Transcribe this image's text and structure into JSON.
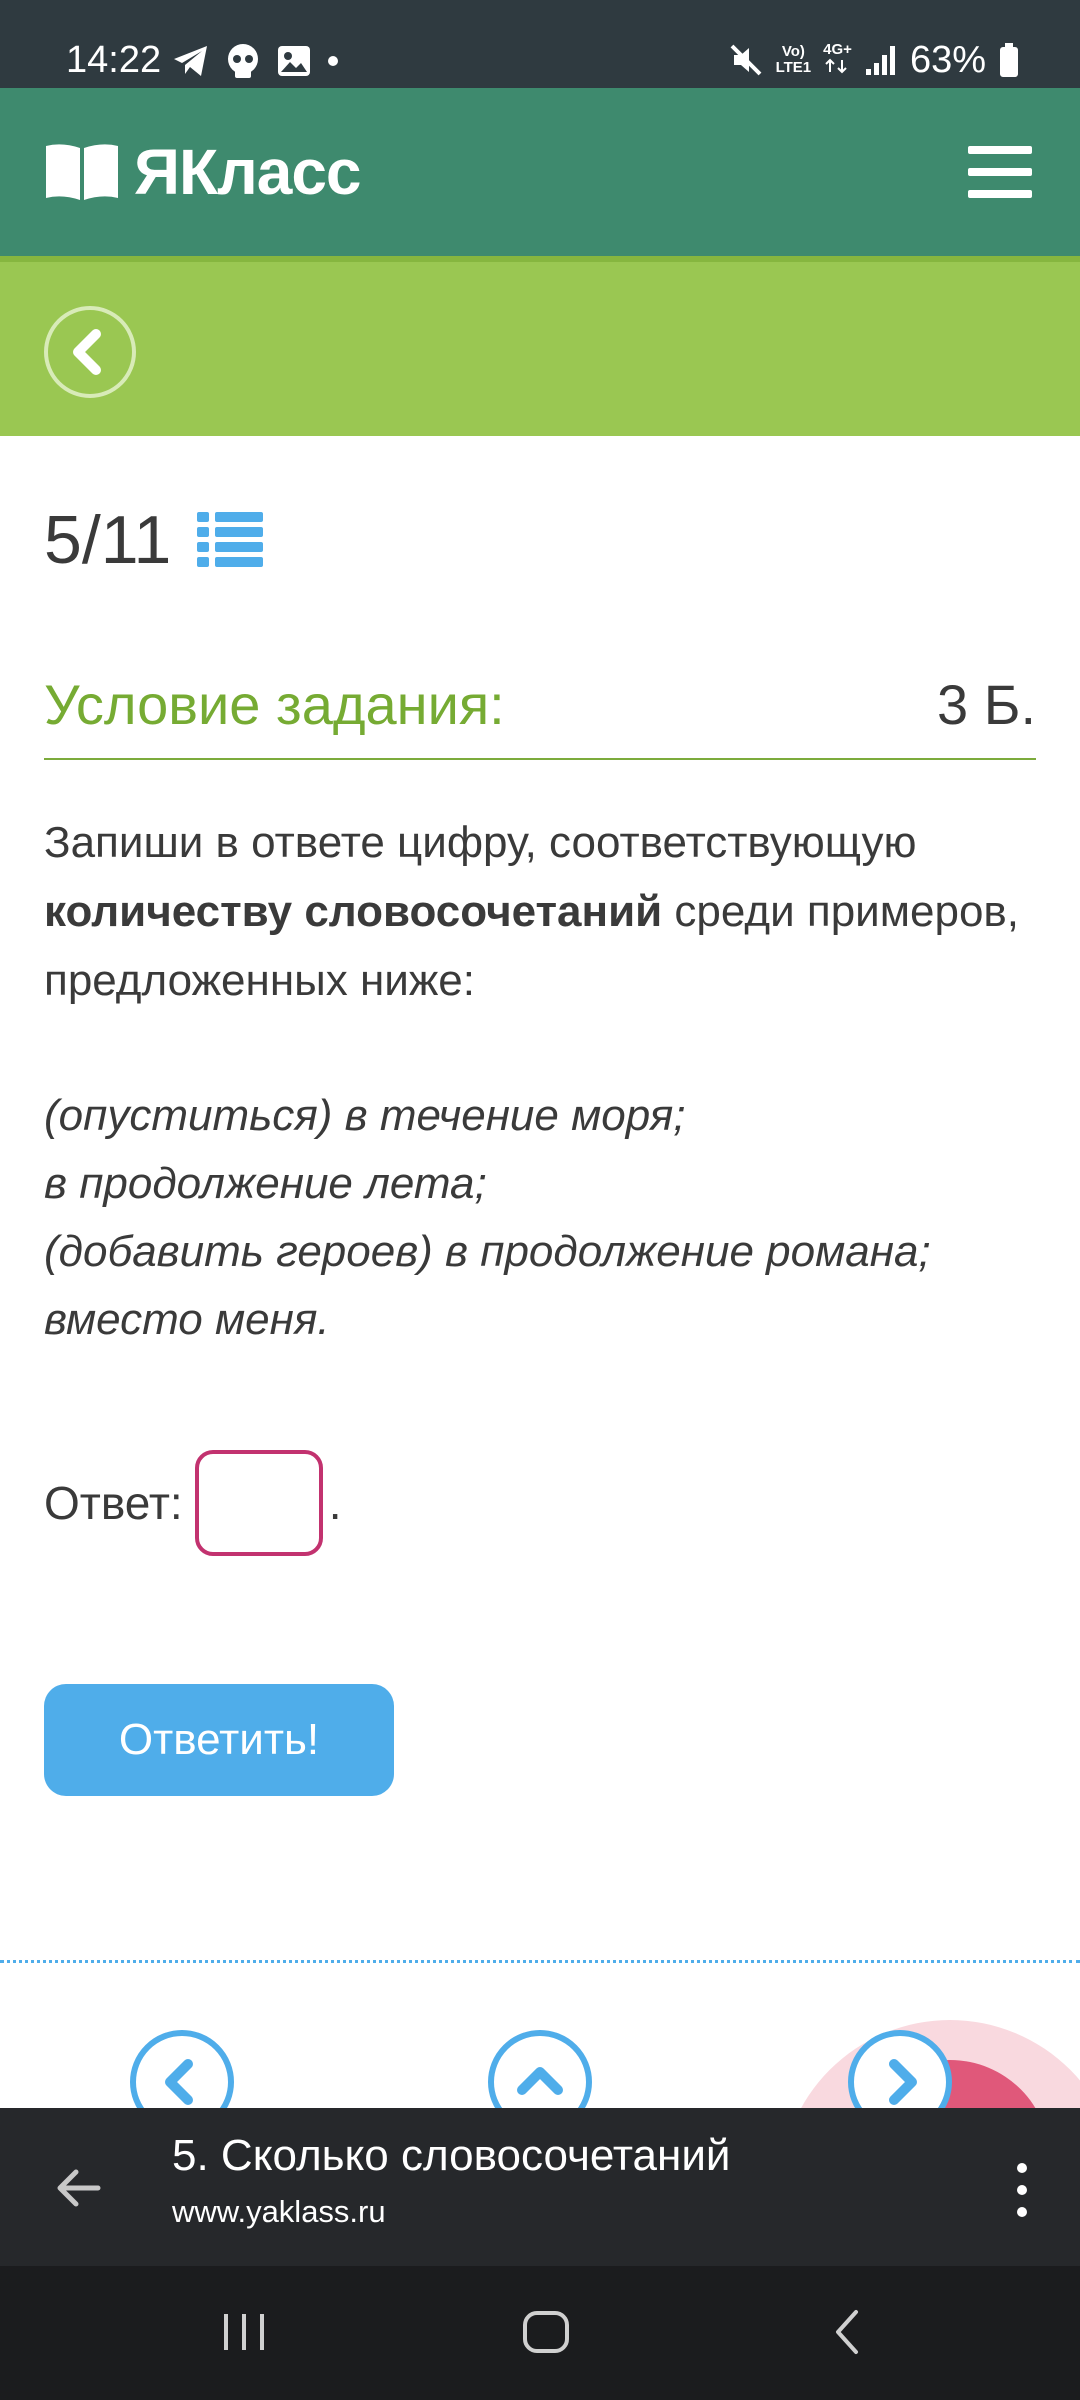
{
  "status_bar": {
    "time": "14:22",
    "battery": "63%",
    "network_top": "Vo)",
    "network_bottom": "LTE1",
    "network_type": "4G+"
  },
  "header": {
    "logo_text": "ЯКласс"
  },
  "task": {
    "progress": "5/11",
    "title": "Условие задания:",
    "points": "3 Б.",
    "instruction_pre": "Запиши в ответе цифру, соответствующую ",
    "instruction_bold": "количеству словосочетаний",
    "instruction_post": " среди примеров, предложенных ниже:",
    "examples": [
      "(опуститься) в течение моря;",
      "в продолжение лета;",
      "(добавить героев) в продолжение романа;",
      "вместо меня."
    ],
    "answer_label": "Ответ:",
    "answer_value": "",
    "answer_suffix": ".",
    "submit_label": "Ответить!"
  },
  "browser": {
    "page_title": "5. Сколько словосочетаний",
    "url": "www.yaklass.ru"
  },
  "colors": {
    "header_green": "#3e8a6e",
    "lime_band": "#9ac752",
    "title_green": "#76ab33",
    "accent_blue": "#4fadea",
    "input_border": "#c2326f"
  }
}
